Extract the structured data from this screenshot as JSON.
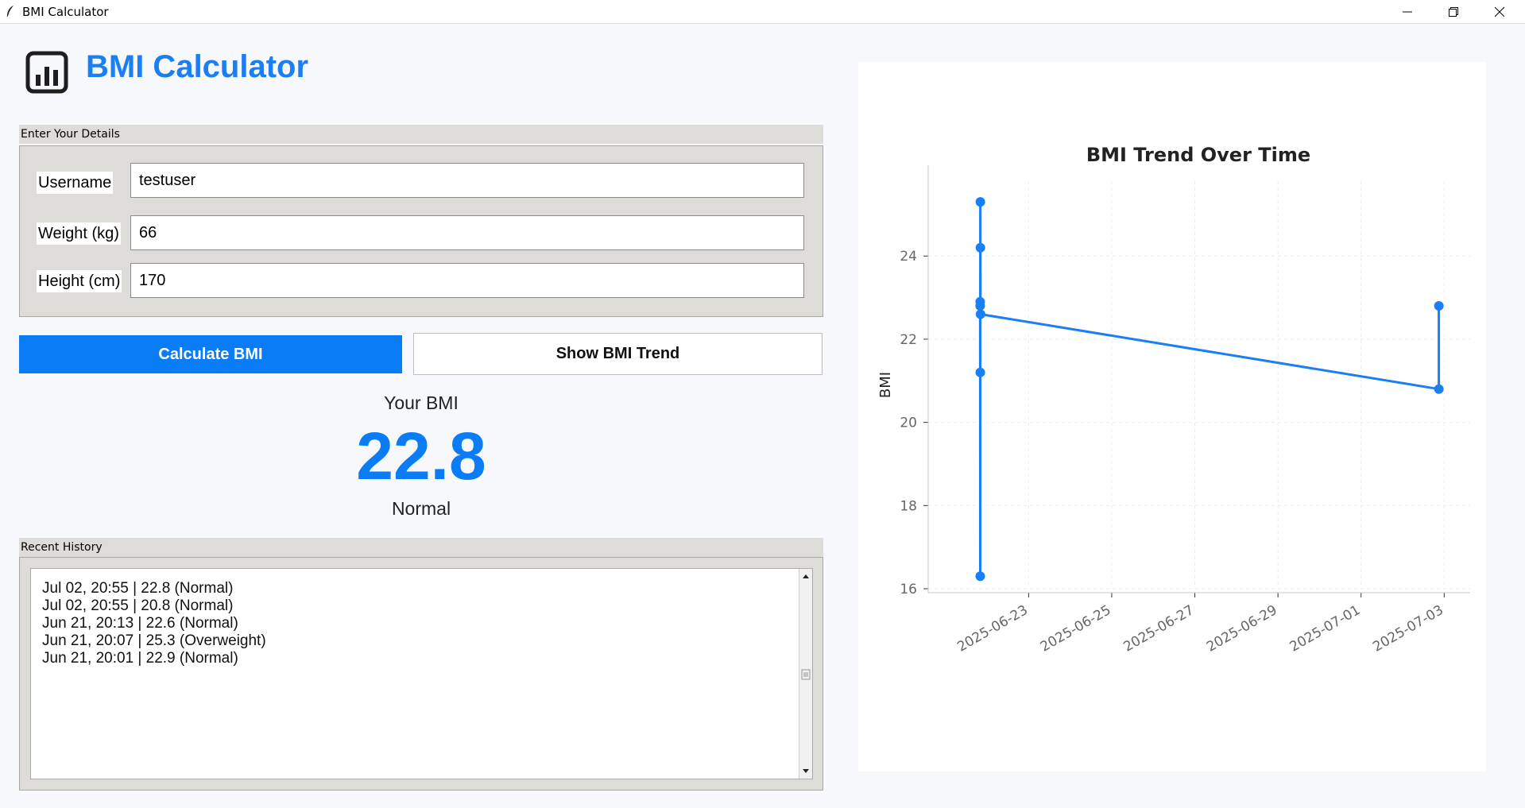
{
  "window": {
    "title": "BMI Calculator"
  },
  "header": {
    "logo_icon": "bar-chart-icon",
    "title": "BMI Calculator"
  },
  "details": {
    "group_label": "Enter Your Details",
    "username_label": "Username",
    "username_value": "testuser",
    "weight_label": "Weight (kg)",
    "weight_value": "66",
    "height_label": "Height (cm)",
    "height_value": "170"
  },
  "actions": {
    "calculate_label": "Calculate BMI",
    "trend_label": "Show BMI Trend"
  },
  "result": {
    "caption": "Your BMI",
    "value": "22.8",
    "category": "Normal"
  },
  "history": {
    "group_label": "Recent History",
    "items": [
      "Jul 02, 20:55 | 22.8 (Normal)",
      "Jul 02, 20:55 | 20.8 (Normal)",
      "Jun 21, 20:13 | 22.6 (Normal)",
      "Jun 21, 20:07 | 25.3 (Overweight)",
      "Jun 21, 20:01 | 22.9 (Normal)"
    ]
  },
  "colors": {
    "accent": "#0a7cf5",
    "line": "#1a7ef5"
  },
  "chart_data": {
    "type": "line",
    "title": "BMI Trend Over Time",
    "xlabel": "",
    "ylabel": "BMI",
    "x_ticks": [
      "2025-06-23",
      "2025-06-25",
      "2025-06-27",
      "2025-06-29",
      "2025-07-01",
      "2025-07-03"
    ],
    "y_ticks": [
      "16",
      "18",
      "20",
      "22",
      "24"
    ],
    "ylim": [
      16,
      25.8
    ],
    "xlim": [
      "2025-06-20T14:00",
      "2025-07-03T15:00"
    ],
    "grid": true,
    "series": [
      {
        "x": [
          "2025-06-21T20:00",
          "2025-06-21T20:01",
          "2025-06-21T20:03",
          "2025-06-21T20:05",
          "2025-06-21T20:07",
          "2025-06-21T20:09",
          "2025-06-21T20:13",
          "2025-07-02T20:55",
          "2025-07-02T20:55"
        ],
        "y": [
          22.8,
          22.9,
          16.3,
          21.2,
          25.3,
          24.2,
          22.6,
          20.8,
          22.8
        ]
      }
    ]
  }
}
